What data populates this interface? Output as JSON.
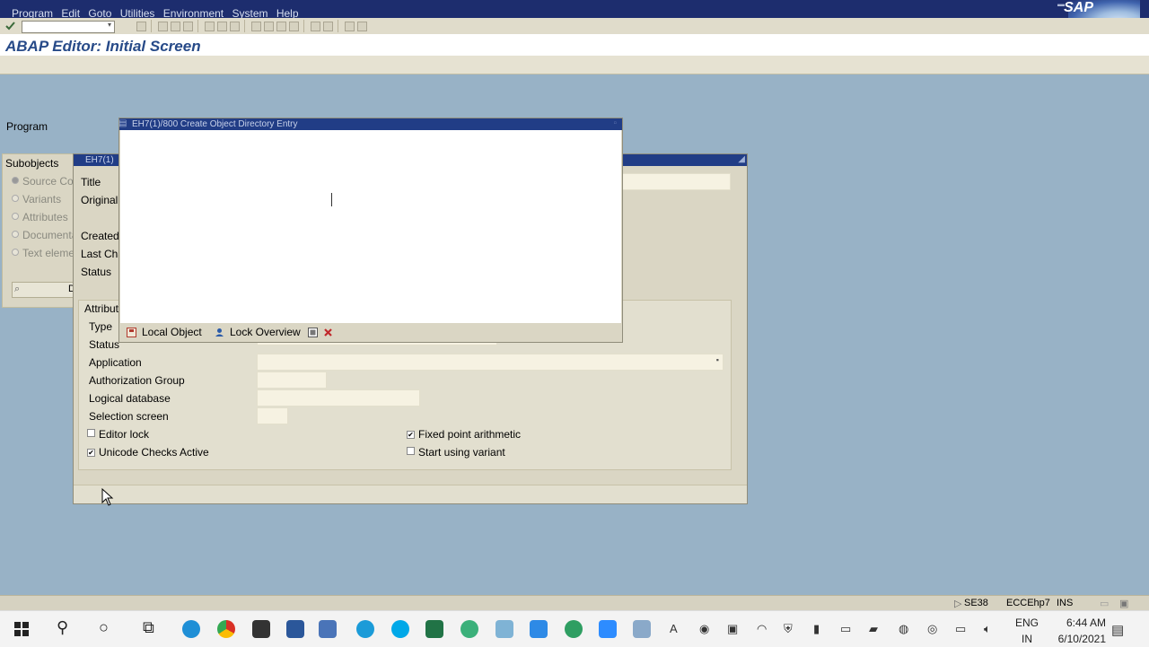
{
  "menu": {
    "items": [
      "Program",
      "Edit",
      "Goto",
      "Utilities",
      "Environment",
      "System",
      "Help"
    ]
  },
  "branding": {
    "logo_text": "SAP"
  },
  "screen": {
    "title": "ABAP Editor: Initial Screen"
  },
  "main": {
    "program_label": "Program",
    "subobjects": {
      "header": "Subobjects",
      "options": [
        "Source Coc",
        "Variants",
        "Attributes",
        "Documenta",
        "Text eleme"
      ],
      "selected_index": 0,
      "display_button_label": "D"
    }
  },
  "attributes_dialog": {
    "title": "EH7(1)",
    "labels": {
      "title": "Title",
      "original": "Original",
      "created": "Created",
      "last_changed": "Last Cha",
      "status": "Status"
    },
    "group": {
      "header": "Attribut",
      "type_label": "Type",
      "status_label": "Status",
      "application_label": "Application",
      "authorization_group_label": "Authorization Group",
      "logical_database_label": "Logical database",
      "selection_screen_label": "Selection screen",
      "application_value": "",
      "authorization_group_value": "",
      "logical_database_value": "",
      "selection_screen_value": ""
    },
    "checkboxes": [
      {
        "label": "Editor lock",
        "checked": false
      },
      {
        "label": "Unicode Checks Active",
        "checked": true
      },
      {
        "label": "Fixed point arithmetic",
        "checked": true
      },
      {
        "label": "Start using variant",
        "checked": false
      }
    ]
  },
  "popup": {
    "title": "EH7(1)/800 Create Object Directory Entry",
    "buttons": {
      "local_object": "Local Object",
      "lock_overview": "Lock Overview"
    }
  },
  "statusbar": {
    "transaction": "SE38",
    "system": "ECCEhp7",
    "mode": "INS"
  },
  "taskbar": {
    "language_line1": "ENG",
    "language_line2": "IN",
    "time": "6:44 AM",
    "date": "6/10/2021",
    "tray_glyph": "A"
  },
  "colors": {
    "menubar": "#1d2d6e",
    "dialog_titlebar": "#213d86",
    "screen_background": "#98b2c6",
    "panel": "#dad6c4",
    "title_text": "#274a88"
  }
}
